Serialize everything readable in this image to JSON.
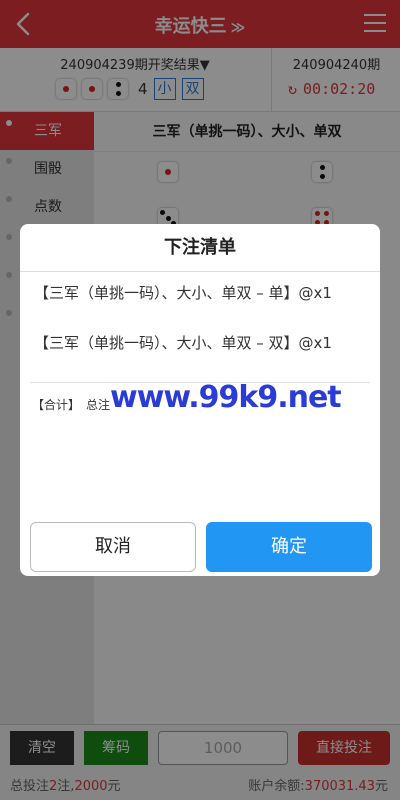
{
  "header": {
    "title": "幸运快三",
    "title_chevron": "≫"
  },
  "result": {
    "current_issue": "240904239期开奖结果▼",
    "dice": [
      1,
      1,
      2
    ],
    "sum": "4",
    "size": "小",
    "parity": "双",
    "next_issue": "240904240期",
    "countdown": "00:02:20"
  },
  "sidebar": {
    "items": [
      {
        "label": "三军"
      },
      {
        "label": "围骰"
      },
      {
        "label": "点数"
      }
    ]
  },
  "main": {
    "section_title": "三军（单挑一码）、大小、单双"
  },
  "modal": {
    "title": "下注清单",
    "bets": [
      "【三军（单挑一码）、大小、单双 – 单】@x1",
      "【三军（单挑一码）、大小、单双 – 双】@x1"
    ],
    "summary_label": "【合计】",
    "summary_total": "总注",
    "cancel_label": "取消",
    "confirm_label": "确定"
  },
  "watermark": {
    "text": "www.99k9.net"
  },
  "bottom": {
    "clear_label": "清空",
    "chips_label": "筹码",
    "amount_placeholder": "1000",
    "direct_bet_label": "直接投注"
  },
  "footer": {
    "total_label": "总投注",
    "bet_count": "2",
    "bet_unit": "注,",
    "bet_amount": "2000",
    "currency": "元",
    "balance_label": "账户余额:",
    "balance": "370031.43",
    "balance_currency": "元"
  },
  "colors": {
    "brand": "#e0363c",
    "confirm": "#2196f3",
    "chips": "#1d8c1d"
  }
}
